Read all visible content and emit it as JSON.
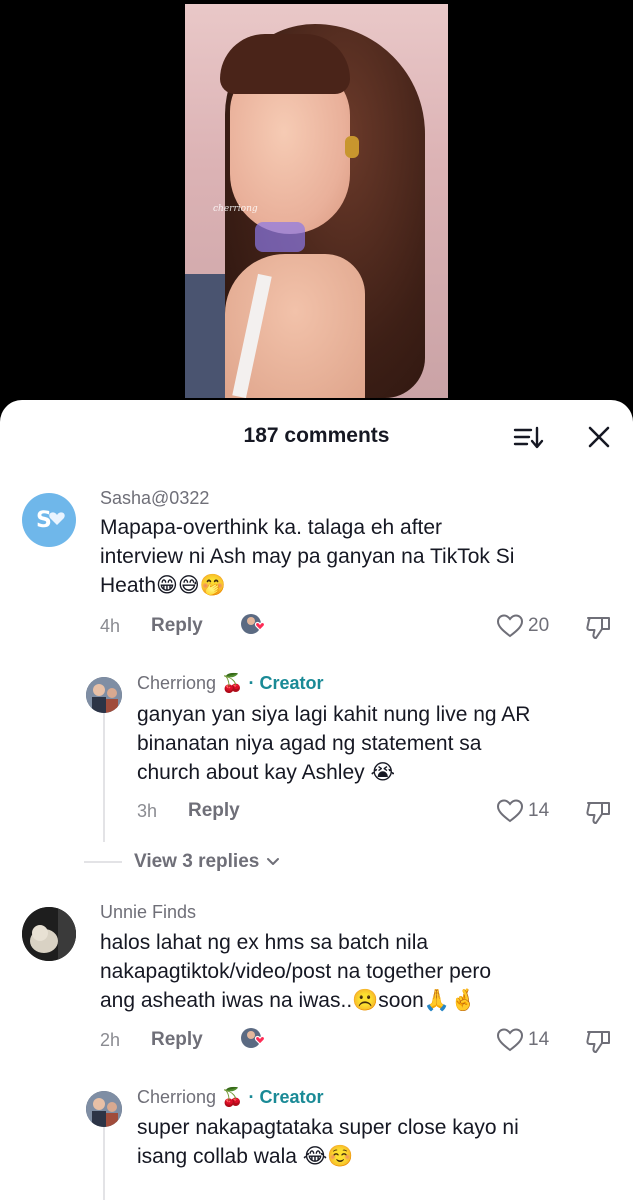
{
  "video": {
    "watermark": "cherriong"
  },
  "comments_sheet": {
    "title": "187 comments",
    "sort_icon": "sort-icon",
    "close_icon": "close-icon"
  },
  "comments": [
    {
      "username": "Sasha@0322",
      "text_lines": [
        "Mapapa-overthink ka. talaga eh after",
        "interview ni Ash may pa ganyan na TikTok Si",
        "Heath😁😅🤭"
      ],
      "time": "4h",
      "reply_label": "Reply",
      "likes": "20"
    },
    {
      "username": "Cherriong 🍒",
      "creator_label": "· Creator",
      "text_lines": [
        "ganyan yan siya lagi kahit nung live ng AR",
        "binanatan niya agad ng statement sa",
        "church about kay Ashley 😭"
      ],
      "time": "3h",
      "reply_label": "Reply",
      "likes": "14"
    },
    {
      "username": "Unnie Finds",
      "text_lines": [
        "halos lahat ng ex hms sa batch nila",
        "nakapagtiktok/video/post na together pero",
        "ang asheath iwas na iwas..☹️soon🙏🤞"
      ],
      "time": "2h",
      "reply_label": "Reply",
      "likes": "14"
    },
    {
      "username": "Cherriong 🍒",
      "creator_label": "· Creator",
      "text_lines": [
        "super nakapagtataka super close kayo ni",
        "isang collab wala 😂☺️"
      ]
    }
  ],
  "view_replies": {
    "label": "View 3 replies"
  },
  "colors": {
    "creator": "#1a8a96",
    "muted": "#6f6f78",
    "text": "#161823"
  }
}
